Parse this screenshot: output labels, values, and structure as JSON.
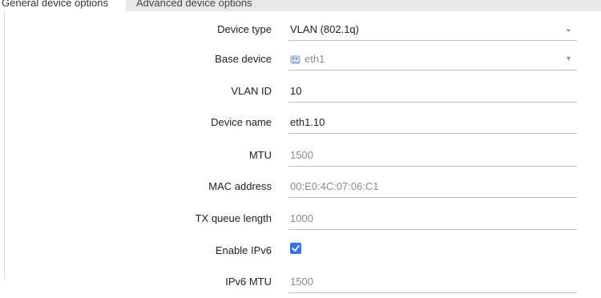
{
  "tabs": [
    {
      "label": "General device options",
      "active": true
    },
    {
      "label": "Advanced device options",
      "active": false
    }
  ],
  "form": {
    "device_type": {
      "label": "Device type",
      "value": "VLAN (802.1q)"
    },
    "base_device": {
      "label": "Base device",
      "value": "eth1",
      "icon": "network-port-icon"
    },
    "vlan_id": {
      "label": "VLAN ID",
      "value": "10"
    },
    "device_name": {
      "label": "Device name",
      "value": "eth1.10"
    },
    "mtu": {
      "label": "MTU",
      "placeholder": "1500"
    },
    "mac_address": {
      "label": "MAC address",
      "placeholder": "00:E0:4C:07:06:C1"
    },
    "tx_queue_length": {
      "label": "TX queue length",
      "placeholder": "1000"
    },
    "enable_ipv6": {
      "label": "Enable IPv6",
      "checked": true
    },
    "ipv6_mtu": {
      "label": "IPv6 MTU",
      "placeholder": "1500"
    }
  },
  "colors": {
    "checkbox_accent": "#3573e6",
    "tab_bar": "#e7e7e7"
  }
}
